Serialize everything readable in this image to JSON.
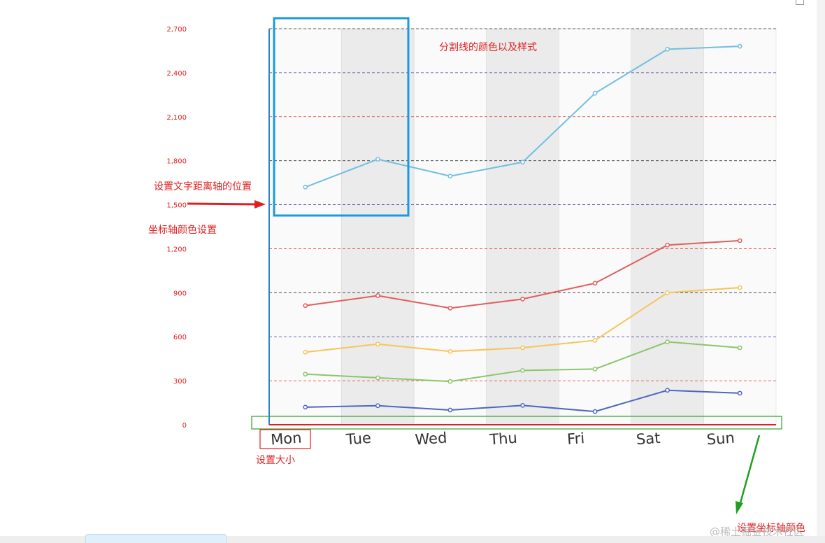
{
  "chart_data": {
    "type": "line",
    "categories": [
      "Mon",
      "Tue",
      "Wed",
      "Thu",
      "Fri",
      "Sat",
      "Sun"
    ],
    "series": [
      {
        "values": [
          1620,
          1810,
          1695,
          1790,
          2260,
          2560,
          2580
        ],
        "color": "#72bfe0"
      },
      {
        "values": [
          812,
          880,
          795,
          857,
          965,
          1225,
          1255
        ],
        "color": "#e05e5e"
      },
      {
        "values": [
          495,
          550,
          500,
          525,
          575,
          900,
          935
        ],
        "color": "#f5c55a"
      },
      {
        "values": [
          345,
          320,
          295,
          370,
          380,
          565,
          525
        ],
        "color": "#8cc56a"
      },
      {
        "values": [
          120,
          130,
          100,
          132,
          90,
          235,
          215
        ],
        "color": "#4e66c0"
      }
    ],
    "ylim": [
      0,
      2700
    ],
    "y_ticks": [
      "0",
      "300",
      "600",
      "900",
      "1,200",
      "1,500",
      "1,800",
      "2,100",
      "2,400",
      "2,700"
    ],
    "grid": true,
    "gridline_colors": [
      "#e23b3b",
      "#3a3aa8",
      "#333333"
    ],
    "axis_line_color": "#2f7fc9",
    "xaxis_line_color": "#e02020",
    "ytick_label_color": "#e02020",
    "xtick_label_color": "#333333",
    "split_area_colors": [
      "#fafafa",
      "#ebebeb"
    ]
  },
  "annotations": {
    "splitline": "分割线的颜色以及样式",
    "label_offset": "设置文字距离轴的位置",
    "axis_color": "坐标轴颜色设置",
    "label_size": "设置大小",
    "axis_line_color": "设置坐标轴颜色",
    "colors": {
      "text": "#e02020",
      "blue_box": "#1a9ae0",
      "green_box": "#2aa02a",
      "green_arrow": "#1fa01f"
    }
  },
  "watermark": "@稀土掘金技术社区"
}
